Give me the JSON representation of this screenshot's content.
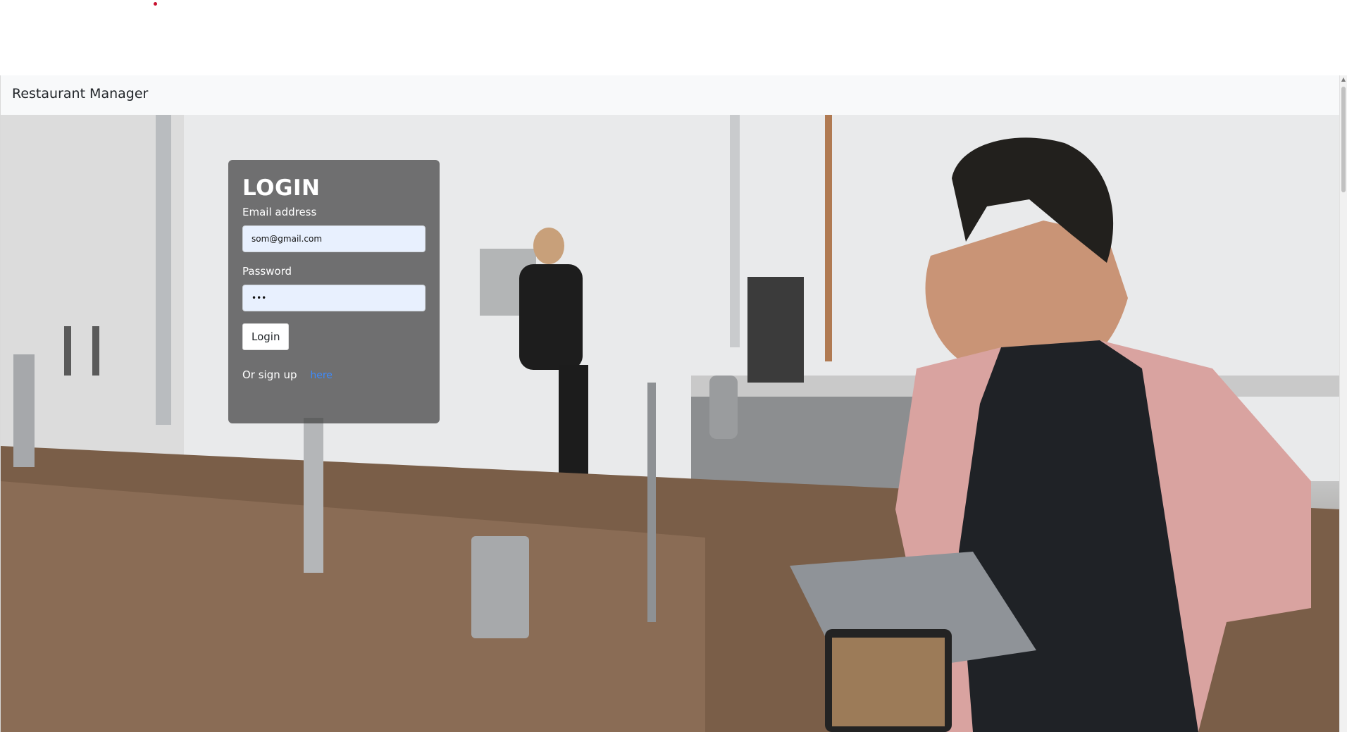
{
  "navbar": {
    "brand": "Restaurant Manager"
  },
  "hero": {
    "background": "photo of a barista at a cafe counter using a point-of-sale tablet"
  },
  "login": {
    "title": "LOGIN",
    "email_label": "Email address",
    "email_value": "som@gmail.com",
    "password_label": "Password",
    "password_value": "abc",
    "button_label": "Login",
    "signup_text": "Or sign up",
    "signup_link": "here"
  },
  "colors": {
    "card_overlay": "#404040",
    "link": "#3d8bfd",
    "navbar_bg": "#f8f9fa",
    "input_autofill_bg": "#e8f0fe"
  }
}
